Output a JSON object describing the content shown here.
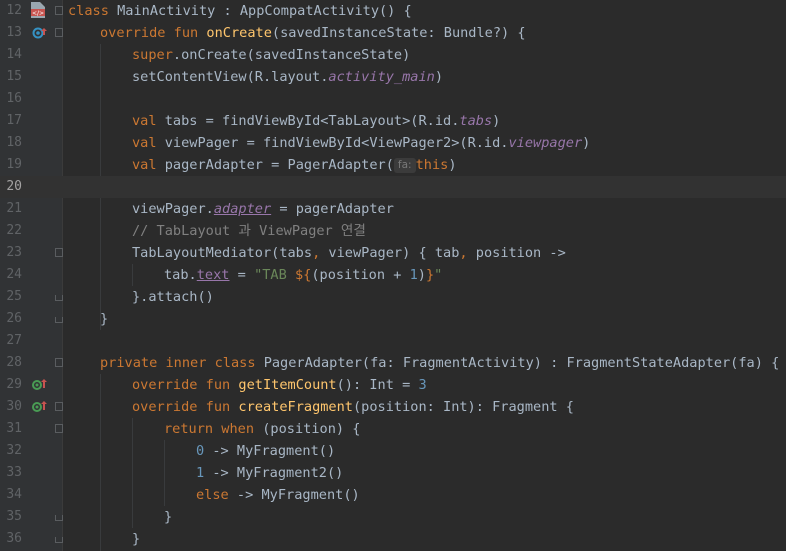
{
  "lines": {
    "l12": {
      "num": "12",
      "a": "class ",
      "b": "MainActivity : AppCompatActivity() {"
    },
    "l13": {
      "num": "13",
      "a": "override fun ",
      "b": "onCreate",
      "c": "(savedInstanceState: Bundle?) {"
    },
    "l14": {
      "num": "14",
      "a": "super",
      "b": ".onCreate(savedInstanceState)"
    },
    "l15": {
      "num": "15",
      "a": "setContentView(R.layout.",
      "b": "activity_main",
      "c": ")"
    },
    "l16": {
      "num": "16"
    },
    "l17": {
      "num": "17",
      "a": "val ",
      "b": "tabs = findViewById<TabLayout>(R.id.",
      "c": "tabs",
      "d": ")"
    },
    "l18": {
      "num": "18",
      "a": "val ",
      "b": "viewPager = findViewById<ViewPager2>(R.id.",
      "c": "viewpager",
      "d": ")"
    },
    "l19": {
      "num": "19",
      "a": "val ",
      "b": "pagerAdapter = PagerAdapter(",
      "hint": "fa:",
      "c": "this",
      "d": ")"
    },
    "l20": {
      "num": "20"
    },
    "l21": {
      "num": "21",
      "a": "viewPager.",
      "b": "adapter",
      "c": " = pagerAdapter"
    },
    "l22": {
      "num": "22",
      "a": "// TabLayout 과 ViewPager 연결"
    },
    "l23": {
      "num": "23",
      "a": "TabLayoutMediator(tabs",
      "b": ",",
      "c": " viewPager) { tab",
      "d": ",",
      "e": " position ->"
    },
    "l24": {
      "num": "24",
      "a": "tab.",
      "b": "text",
      "c": " = ",
      "d": "\"TAB ",
      "e": "${",
      "f": "(position + ",
      "g": "1",
      "h": ")",
      "i": "}",
      "j": "\""
    },
    "l25": {
      "num": "25",
      "a": "}.attach()"
    },
    "l26": {
      "num": "26",
      "a": "}"
    },
    "l27": {
      "num": "27"
    },
    "l28": {
      "num": "28",
      "a": "private inner class ",
      "b": "PagerAdapter(fa: FragmentActivity) : FragmentStateAdapter(fa) {"
    },
    "l29": {
      "num": "29",
      "a": "override fun ",
      "b": "getItemCount",
      "c": "(): Int = ",
      "d": "3"
    },
    "l30": {
      "num": "30",
      "a": "override fun ",
      "b": "createFragment",
      "c": "(position: Int): Fragment {"
    },
    "l31": {
      "num": "31",
      "a": "return when ",
      "b": "(position) {"
    },
    "l32": {
      "num": "32",
      "a": "0",
      "b": " -> MyFragment()"
    },
    "l33": {
      "num": "33",
      "a": "1",
      "b": " -> MyFragment2()"
    },
    "l34": {
      "num": "34",
      "a": "else ",
      "b": "-> MyFragment()"
    },
    "l35": {
      "num": "35",
      "a": "}"
    },
    "l36": {
      "num": "36",
      "a": "}"
    }
  },
  "colors": {
    "background": "#2b2b2b",
    "gutter": "#313335",
    "keyword": "#cc7832",
    "function": "#ffc66d",
    "string": "#6a8759",
    "number": "#6897bb",
    "property": "#9876aa",
    "comment": "#808080",
    "text": "#a9b7c6"
  },
  "icons": {
    "line12": "class-file-icon",
    "line13": "override-run-icon",
    "line29": "implements-method-icon",
    "line30": "implements-method-icon"
  }
}
